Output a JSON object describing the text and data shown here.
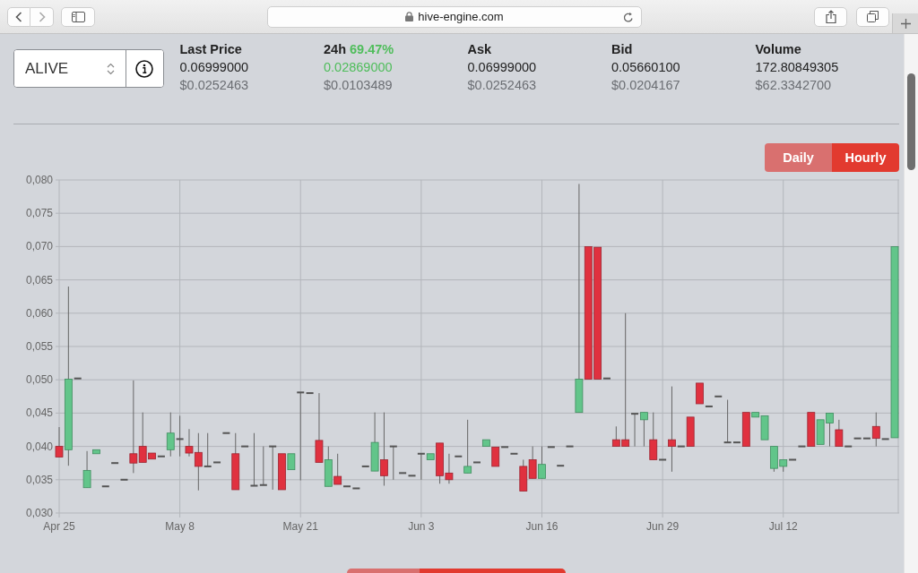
{
  "browser": {
    "url": "hive-engine.com"
  },
  "token_selector": {
    "value": "ALIVE"
  },
  "stats": [
    {
      "label": "Last Price",
      "kind": "plain",
      "price": "0.06999000",
      "usd": "$0.0252463"
    },
    {
      "label": "24h",
      "change": "69.47%",
      "kind": "change",
      "price": "0.02869000",
      "usd": "$0.0103489"
    },
    {
      "label": "Ask",
      "kind": "plain",
      "price": "0.06999000",
      "usd": "$0.0252463"
    },
    {
      "label": "Bid",
      "kind": "plain",
      "price": "0.05660100",
      "usd": "$0.0204167"
    },
    {
      "label": "Volume",
      "kind": "plain",
      "price": "172.80849305",
      "usd": "$62.3342700"
    }
  ],
  "interval_toggle": [
    {
      "label": "Daily",
      "selected": false
    },
    {
      "label": "Hourly",
      "selected": true
    }
  ],
  "chart_data": {
    "type": "candlestick",
    "grid": true,
    "ylim": [
      0.03,
      0.08
    ],
    "yticks": [
      {
        "value": 0.03,
        "label": "0,030"
      },
      {
        "value": 0.035,
        "label": "0,035"
      },
      {
        "value": 0.04,
        "label": "0,040"
      },
      {
        "value": 0.045,
        "label": "0,045"
      },
      {
        "value": 0.05,
        "label": "0,050"
      },
      {
        "value": 0.055,
        "label": "0,055"
      },
      {
        "value": 0.06,
        "label": "0,060"
      },
      {
        "value": 0.065,
        "label": "0,065"
      },
      {
        "value": 0.07,
        "label": "0,070"
      },
      {
        "value": 0.075,
        "label": "0,075"
      },
      {
        "value": 0.08,
        "label": "0,080"
      }
    ],
    "categories": [
      "Apr 25",
      null,
      null,
      null,
      null,
      null,
      null,
      null,
      null,
      null,
      null,
      null,
      null,
      "May 8",
      null,
      null,
      null,
      null,
      null,
      null,
      null,
      null,
      null,
      null,
      null,
      null,
      "May 21",
      null,
      null,
      null,
      null,
      null,
      null,
      null,
      null,
      null,
      null,
      null,
      null,
      "Jun 3",
      null,
      null,
      null,
      null,
      null,
      null,
      null,
      null,
      null,
      null,
      null,
      null,
      "Jun 16",
      null,
      null,
      null,
      null,
      null,
      null,
      null,
      null,
      null,
      null,
      null,
      null,
      "Jun 29",
      null,
      null,
      null,
      null,
      null,
      null,
      null,
      null,
      null,
      null,
      null,
      null,
      "Jul 12",
      null,
      null,
      null,
      null,
      null,
      null,
      null,
      null,
      null,
      null,
      null,
      null
    ],
    "ohlc": [
      [
        0.04,
        0.0429,
        0.0384,
        0.0384
      ],
      [
        0.0395,
        0.064,
        0.0371,
        0.0501
      ],
      [
        0.0502,
        0.0502,
        0.0502,
        0.0502
      ],
      [
        0.0338,
        0.0393,
        0.0338,
        0.0364
      ],
      [
        0.0389,
        0.0395,
        0.0389,
        0.0395
      ],
      [
        0.034,
        0.034,
        0.034,
        0.034
      ],
      [
        0.0375,
        0.0375,
        0.0375,
        0.0375
      ],
      [
        0.035,
        0.035,
        0.035,
        0.035
      ],
      [
        0.0389,
        0.0499,
        0.036,
        0.0375
      ],
      [
        0.04,
        0.0451,
        0.0376,
        0.0376
      ],
      [
        0.039,
        0.039,
        0.0381,
        0.0381
      ],
      [
        0.0385,
        0.0385,
        0.0385,
        0.0385
      ],
      [
        0.0395,
        0.0451,
        0.0385,
        0.042
      ],
      [
        0.0411,
        0.0446,
        0.0385,
        0.0411
      ],
      [
        0.04,
        0.0426,
        0.0385,
        0.039
      ],
      [
        0.0391,
        0.042,
        0.0334,
        0.037
      ],
      [
        0.037,
        0.042,
        0.037,
        0.037
      ],
      [
        0.0376,
        0.0376,
        0.0376,
        0.0376
      ],
      [
        0.042,
        0.042,
        0.042,
        0.042
      ],
      [
        0.0389,
        0.042,
        0.0335,
        0.0335
      ],
      [
        0.04,
        0.04,
        0.04,
        0.04
      ],
      [
        0.0341,
        0.042,
        0.0341,
        0.0341
      ],
      [
        0.0342,
        0.04,
        0.0342,
        0.0342
      ],
      [
        0.04,
        0.04,
        0.0335,
        0.04
      ],
      [
        0.0389,
        0.0389,
        0.0335,
        0.0335
      ],
      [
        0.0365,
        0.0389,
        0.0365,
        0.0389
      ],
      [
        0.0481,
        0.0481,
        0.0349,
        0.0481
      ],
      [
        0.048,
        0.048,
        0.048,
        0.048
      ],
      [
        0.0409,
        0.048,
        0.0376,
        0.0376
      ],
      [
        0.034,
        0.04,
        0.034,
        0.038
      ],
      [
        0.0355,
        0.0389,
        0.0343,
        0.0343
      ],
      [
        0.034,
        0.034,
        0.034,
        0.034
      ],
      [
        0.0337,
        0.0337,
        0.0337,
        0.0337
      ],
      [
        0.037,
        0.037,
        0.037,
        0.037
      ],
      [
        0.0363,
        0.0451,
        0.0363,
        0.0406
      ],
      [
        0.038,
        0.0451,
        0.0341,
        0.0356
      ],
      [
        0.04,
        0.04,
        0.035,
        0.04
      ],
      [
        0.036,
        0.036,
        0.036,
        0.036
      ],
      [
        0.0356,
        0.0356,
        0.0356,
        0.0356
      ],
      [
        0.0389,
        0.0389,
        0.035,
        0.0389
      ],
      [
        0.038,
        0.0389,
        0.038,
        0.0389
      ],
      [
        0.0405,
        0.0405,
        0.0344,
        0.0356
      ],
      [
        0.036,
        0.0389,
        0.0344,
        0.035
      ],
      [
        0.0385,
        0.0385,
        0.0385,
        0.0385
      ],
      [
        0.036,
        0.044,
        0.036,
        0.037
      ],
      [
        0.0376,
        0.0376,
        0.0376,
        0.0376
      ],
      [
        0.04,
        0.041,
        0.04,
        0.041
      ],
      [
        0.0399,
        0.0399,
        0.037,
        0.037
      ],
      [
        0.0399,
        0.0399,
        0.0399,
        0.0399
      ],
      [
        0.0389,
        0.0389,
        0.0389,
        0.0389
      ],
      [
        0.037,
        0.038,
        0.0333,
        0.0333
      ],
      [
        0.038,
        0.04,
        0.0352,
        0.0352
      ],
      [
        0.0352,
        0.04,
        0.0352,
        0.0373
      ],
      [
        0.0399,
        0.0399,
        0.0399,
        0.0399
      ],
      [
        0.0371,
        0.0371,
        0.0371,
        0.0371
      ],
      [
        0.04,
        0.04,
        0.04,
        0.04
      ],
      [
        0.0451,
        0.0794,
        0.0451,
        0.0501
      ],
      [
        0.07,
        0.07,
        0.0501,
        0.0501
      ],
      [
        0.0699,
        0.0699,
        0.0501,
        0.0501
      ],
      [
        0.0502,
        0.0502,
        0.0502,
        0.0502
      ],
      [
        0.041,
        0.043,
        0.04,
        0.04
      ],
      [
        0.041,
        0.06,
        0.04,
        0.04
      ],
      [
        0.0449,
        0.0449,
        0.04,
        0.0449
      ],
      [
        0.044,
        0.0451,
        0.04,
        0.0451
      ],
      [
        0.041,
        0.0451,
        0.038,
        0.038
      ],
      [
        0.038,
        0.038,
        0.038,
        0.038
      ],
      [
        0.041,
        0.049,
        0.0362,
        0.04
      ],
      [
        0.04,
        0.04,
        0.04,
        0.04
      ],
      [
        0.0444,
        0.0444,
        0.04,
        0.04
      ],
      [
        0.0495,
        0.0495,
        0.0464,
        0.0464
      ],
      [
        0.046,
        0.046,
        0.046,
        0.046
      ],
      [
        0.0475,
        0.0475,
        0.0475,
        0.0475
      ],
      [
        0.0406,
        0.047,
        0.0406,
        0.0406
      ],
      [
        0.0406,
        0.0406,
        0.0406,
        0.0406
      ],
      [
        0.0451,
        0.0451,
        0.04,
        0.04
      ],
      [
        0.0444,
        0.0451,
        0.0444,
        0.0451
      ],
      [
        0.041,
        0.0446,
        0.041,
        0.0446
      ],
      [
        0.0367,
        0.04,
        0.0362,
        0.04
      ],
      [
        0.037,
        0.038,
        0.0362,
        0.038
      ],
      [
        0.038,
        0.038,
        0.038,
        0.038
      ],
      [
        0.04,
        0.04,
        0.04,
        0.04
      ],
      [
        0.0451,
        0.0451,
        0.04,
        0.04
      ],
      [
        0.0403,
        0.044,
        0.0403,
        0.044
      ],
      [
        0.0435,
        0.045,
        0.04,
        0.045
      ],
      [
        0.0425,
        0.044,
        0.04,
        0.04
      ],
      [
        0.04,
        0.04,
        0.04,
        0.04
      ],
      [
        0.0412,
        0.0412,
        0.0412,
        0.0412
      ],
      [
        0.0412,
        0.0412,
        0.0412,
        0.0412
      ],
      [
        0.043,
        0.0451,
        0.04,
        0.0412
      ],
      [
        0.0411,
        0.0411,
        0.0411,
        0.0411
      ],
      [
        0.0413,
        0.07,
        0.0413,
        0.07
      ]
    ]
  }
}
